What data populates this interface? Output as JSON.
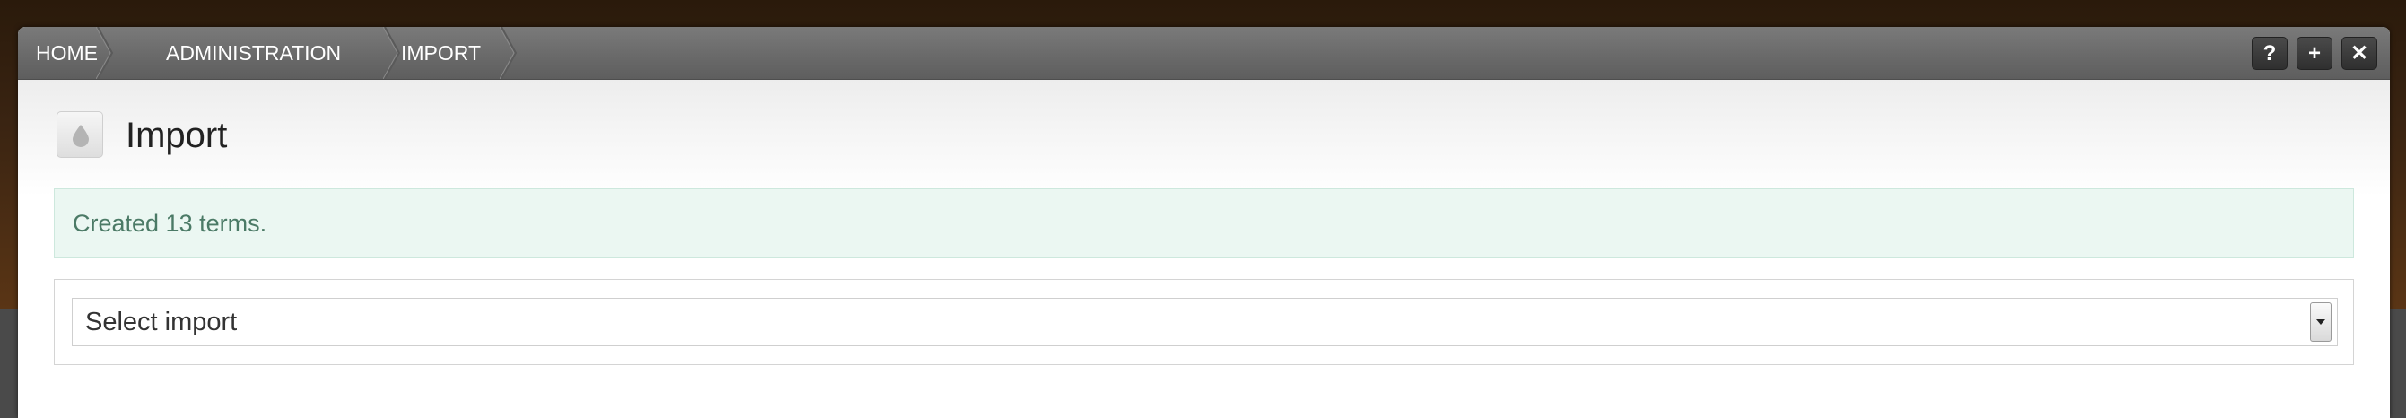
{
  "breadcrumbs": [
    "HOME",
    "ADMINISTRATION",
    "IMPORT"
  ],
  "window_actions": {
    "help_glyph": "?",
    "expand_glyph": "+",
    "close_glyph": "✕"
  },
  "page": {
    "title": "Import",
    "icon": "drop-icon"
  },
  "status_message": "Created 13 terms.",
  "import_select": {
    "selected_value": "Select import"
  },
  "colors": {
    "titlebar": "#6a6a6a",
    "message_bg": "#ebf7f2",
    "message_text": "#4b7a66",
    "backdrop": "#3a2412"
  }
}
